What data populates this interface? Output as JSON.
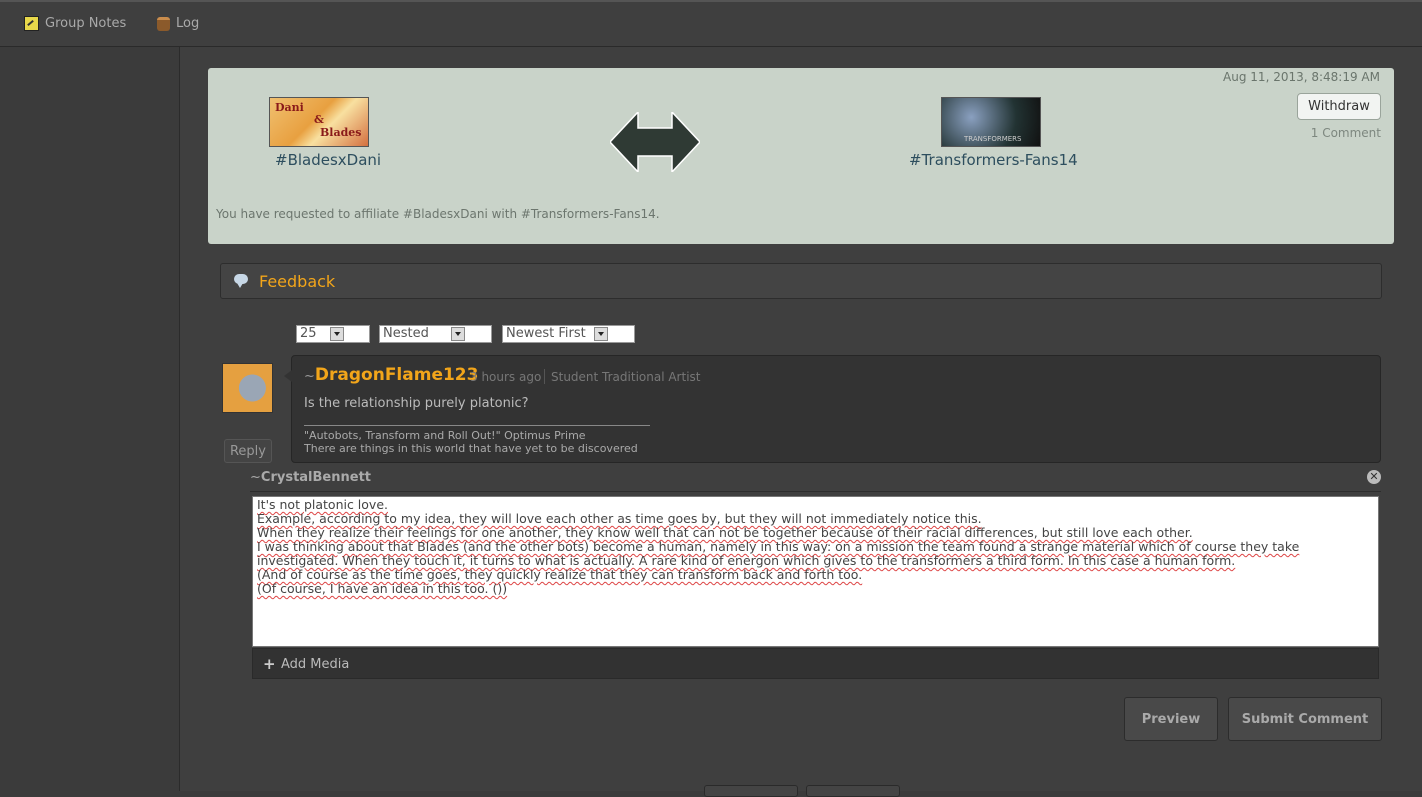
{
  "topbar": {
    "group_notes_label": "Group Notes",
    "log_label": "Log"
  },
  "affiliation": {
    "date": "Aug 11, 2013, 8:48:19 AM",
    "withdraw_label": "Withdraw",
    "comment_count": "1 Comment",
    "group_a": {
      "name": "#BladesxDani",
      "thumb_text_1": "Dani",
      "thumb_text_2": "&",
      "thumb_text_3": "Blades"
    },
    "group_b": {
      "name": "#Transformers-Fans14",
      "thumb_text": "TRANSFORMERS"
    },
    "message": "You have requested to affiliate #BladesxDani with #Transformers-Fans14."
  },
  "feedback": {
    "title": "Feedback",
    "per_page": "25",
    "view_mode": "Nested",
    "sort_order": "Newest First"
  },
  "comment": {
    "tilde": "~",
    "author": "DragonFlame123",
    "time": "3 hours ago",
    "role": "Student Traditional Artist",
    "text": "Is the relationship purely platonic?",
    "signature_1": "\"Autobots, Transform and Roll Out!\" Optimus Prime",
    "signature_2": "There are things in this world that have yet to be discovered",
    "reply_label": "Reply"
  },
  "reply_form": {
    "tilde": "~",
    "author": "CrystalBennett",
    "close_symbol": "✕",
    "lines": [
      "It's not platonic love.",
      "Example, according to my idea, they will love each other as time goes by, but they will not immediately notice this.",
      "When they realize their feelings for one another, they know well that can not be together because of their racial differences, but still love each other.",
      "I was thinking about that Blades (and the other bots) become a human, namely in this way: on a mission the team found a strange material which of course they take",
      "investigated. When they touch it, it turns to what is actually. A rare kind of energon which gives to the transformers a third form. In this case a human form.",
      "(And of course as the time goes, they quickly realize that they can transform back and forth too.",
      "(Of course, I have an idea in this too. ())"
    ],
    "add_media_label": "Add Media",
    "preview_label": "Preview",
    "submit_label": "Submit Comment"
  },
  "colors": {
    "accent": "#f2a51a",
    "panel_bg": "#c9d3c9",
    "link": "#2d4e5e"
  }
}
